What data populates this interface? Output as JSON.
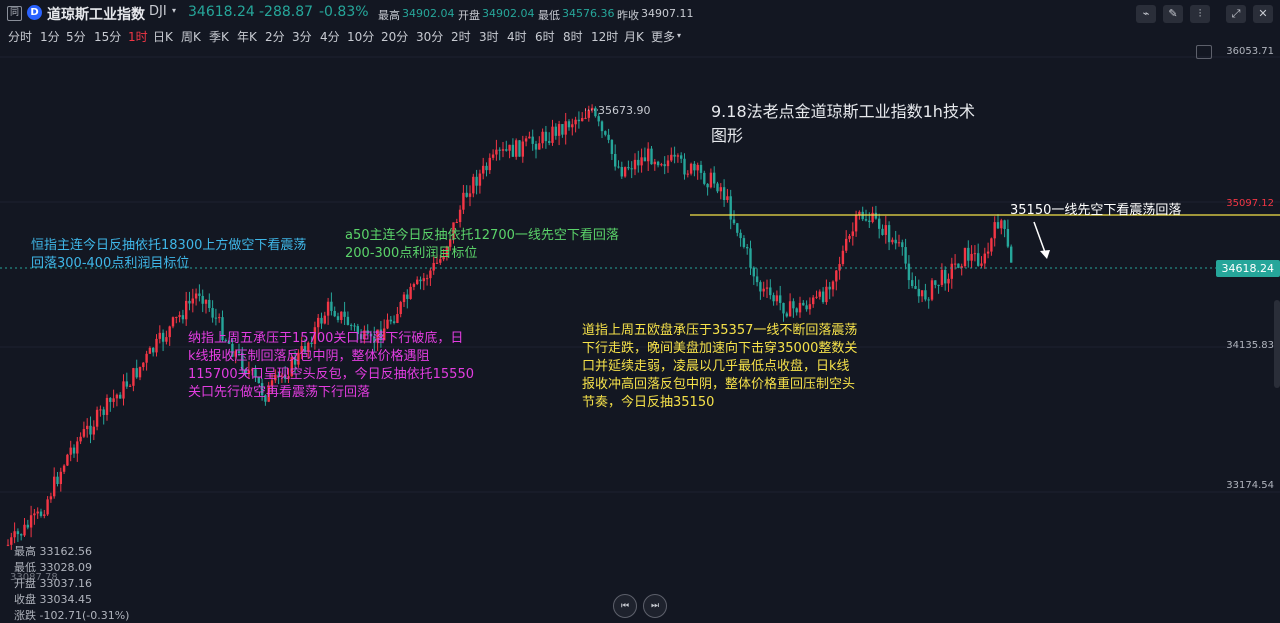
{
  "header": {
    "logo_glyph": "同",
    "badge_glyph": "D",
    "name": "道琼斯工业指数",
    "code": "DJI",
    "caret": "▾",
    "last": "34618.24",
    "change": "-288.87",
    "change_pct": "-0.83%",
    "high_label": "最高",
    "high": "34902.04",
    "open_label": "开盘",
    "open": "34902.04",
    "low_label": "最低",
    "low": "34576.36",
    "prev_label": "昨收",
    "prev": "34907.11"
  },
  "toolbar": {
    "indicator_icon": "chart-indicator-icon",
    "draw_icon": "pencil-icon",
    "candle_icon": "candlestick-icon",
    "expand_icon": "expand-icon",
    "close_icon": "close-icon",
    "glyphs": [
      "⌁",
      "✎",
      "⫶",
      "⤢",
      "✕"
    ]
  },
  "intervals": {
    "items": [
      "分时",
      "1分",
      "5分",
      "15分",
      "1时",
      "日K",
      "周K",
      "季K",
      "年K",
      "2分",
      "3分",
      "4分",
      "10分",
      "20分",
      "30分",
      "2时",
      "3时",
      "4时",
      "6时",
      "8时",
      "12时",
      "月K",
      "更多"
    ],
    "active": "1时",
    "more_caret": "▾"
  },
  "axis": {
    "top_partial": "36053.71",
    "labels": [
      "34135.83",
      "33174.54"
    ],
    "line_tag": "35097.12",
    "price_tag": "34618.24"
  },
  "colors": {
    "up": "#f23645",
    "down": "#26a69a",
    "accent": "#2962ff",
    "note_cyan": "#3fb7e8",
    "note_green": "#5bd46a",
    "note_magenta": "#e23de0",
    "note_yellow": "#f5e14a",
    "resistance": "#f5e14a"
  },
  "annotations": {
    "title": "9.18法老点金道琼斯工业指数1h技术\n图形",
    "high_marker": "35673.90",
    "line_label": "35150一线先空下看震荡回落",
    "hang_seng": "恒指主连今日反抽依托18300上方做空下看震荡\n回落300-400点利润目标位",
    "a50": "a50主连今日反抽依托12700一线先空下看回落\n200-300点利润目标位",
    "nasdaq": "纳指上周五承压于15700关口回落下行破底，日\nk线报收压制回落反包中阴，整体价格遇阻\n115700关口呈现空头反包，今日反抽依托15550\n关口先行做空再看震荡下行回落",
    "dow": "道指上周五欧盘承压于35357一线不断回落震荡\n下行走跌，晚间美盘加速向下击穿35000整数关\n口并延续走弱，凌晨以几乎最低点收盘，日k线\n报收冲高回落反包中阴，整体价格重回压制空头\n节奏，今日反抽35150"
  },
  "ohlc_panel": {
    "high": "最高 33162.56",
    "low": "最低 33028.09",
    "open": "开盘 33037.16",
    "close": "收盘 33034.45",
    "change": "涨跌 -102.71(-0.31%)",
    "overlap": "33087.78"
  },
  "nav": {
    "prev_icon": "skip-back-icon",
    "next_icon": "skip-forward-icon",
    "prev_glyph": "⏮",
    "next_glyph": "⏭"
  }
}
